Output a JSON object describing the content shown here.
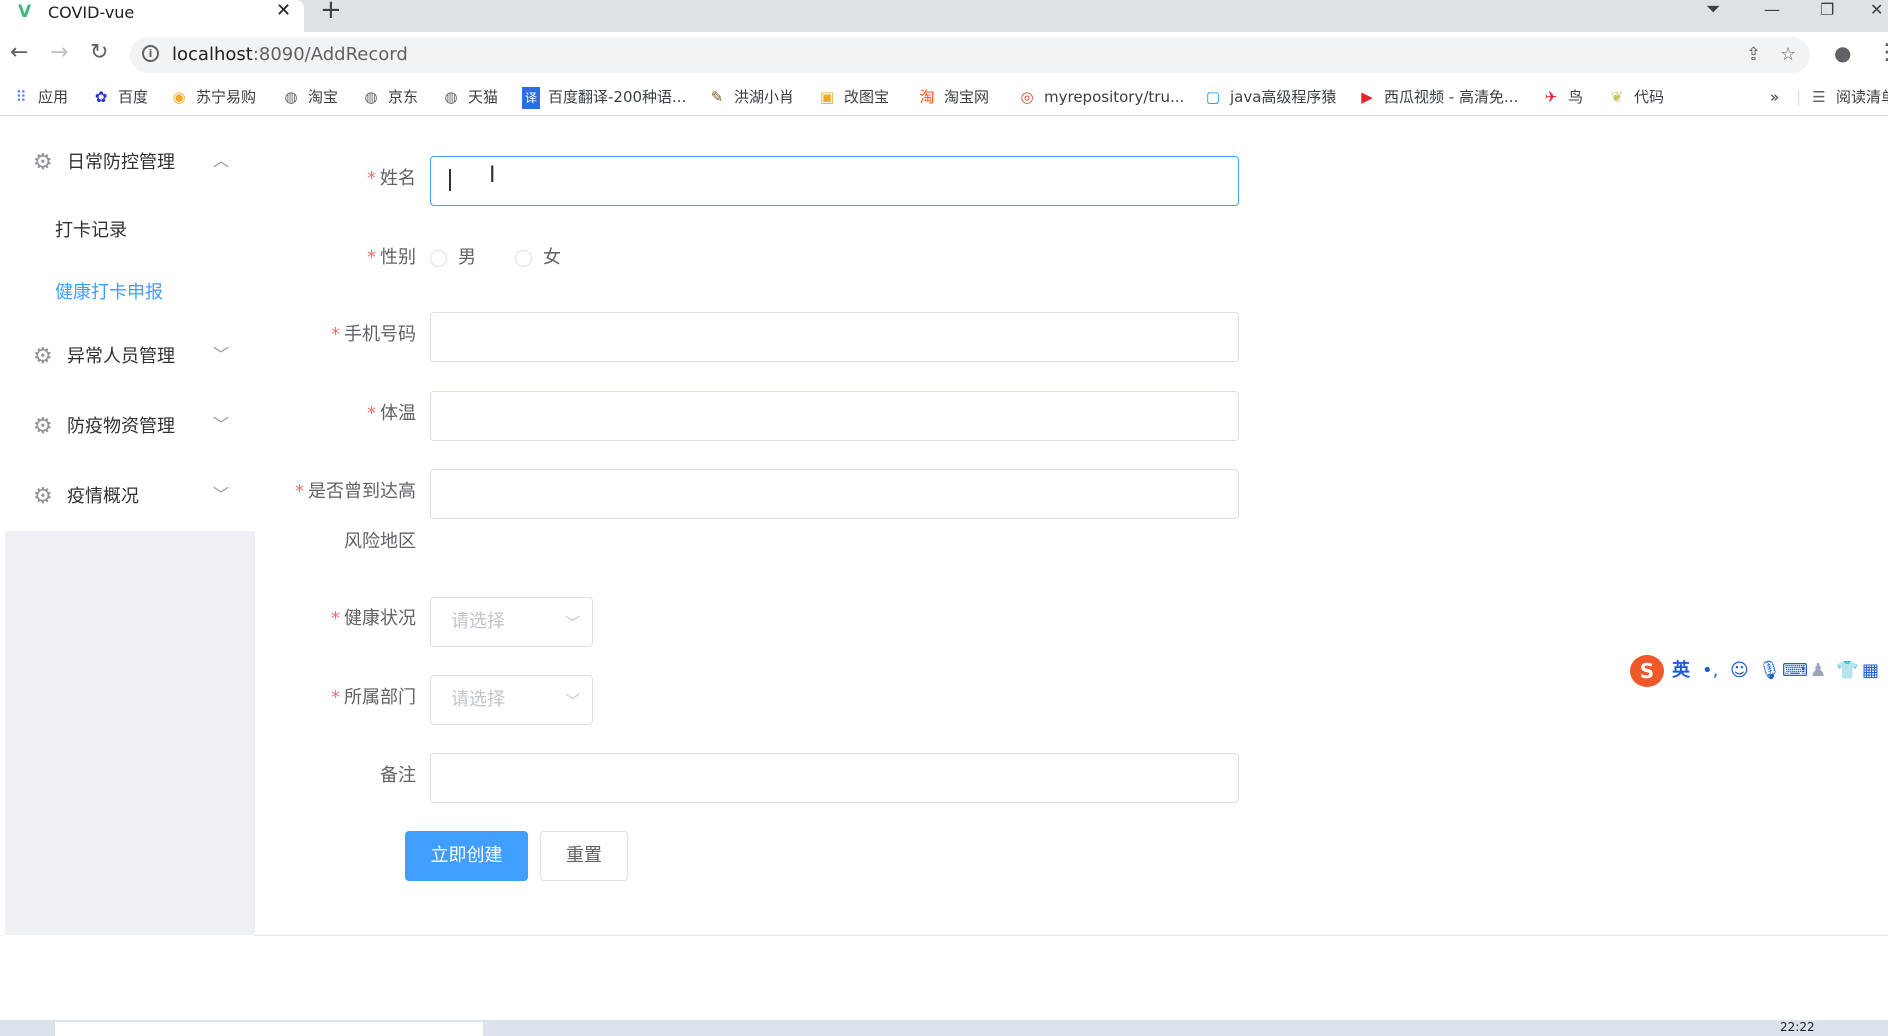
{
  "browser": {
    "tab_title": "COVID-vue",
    "tab_close": "✕",
    "new_tab": "+",
    "url_host": "localhost",
    "url_rest": ":8090/AddRecord",
    "window_controls": [
      "—",
      "❐",
      "✕"
    ]
  },
  "bookmarks": [
    {
      "icon": "apps-grid-icon",
      "label": "应用"
    },
    {
      "icon": "baidu-paw-icon",
      "label": "百度"
    },
    {
      "icon": "suning-lion-icon",
      "label": "苏宁易购"
    },
    {
      "icon": "globe-icon",
      "label": "淘宝"
    },
    {
      "icon": "globe-icon",
      "label": "京东"
    },
    {
      "icon": "globe-icon",
      "label": "天猫"
    },
    {
      "icon": "translate-icon",
      "label": "百度翻译-200种语..."
    },
    {
      "icon": "honghu-icon",
      "label": "洪湖小肖"
    },
    {
      "icon": "gaitubao-icon",
      "label": "改图宝"
    },
    {
      "icon": "taobao-icon",
      "label": "淘宝网"
    },
    {
      "icon": "chrome-icon",
      "label": "myrepository/tru..."
    },
    {
      "icon": "bilibili-tv-icon",
      "label": "java高级程序猿"
    },
    {
      "icon": "xigua-play-icon",
      "label": "西瓜视频 - 高清免..."
    },
    {
      "icon": "bird-icon",
      "label": "鸟"
    },
    {
      "icon": "code-leaf-icon",
      "label": "代码"
    }
  ],
  "bookmarks_more": "»",
  "reading_list": "阅读清单",
  "sidebar": {
    "menus": [
      {
        "label": "日常防控管理",
        "expanded": true
      },
      {
        "label": "异常人员管理",
        "expanded": false
      },
      {
        "label": "防疫物资管理",
        "expanded": false
      },
      {
        "label": "疫情概况",
        "expanded": false
      }
    ],
    "sub_items": [
      {
        "label": "打卡记录",
        "active": false
      },
      {
        "label": "健康打卡申报",
        "active": true
      }
    ],
    "chevron_up": "︿",
    "chevron_down": "﹀"
  },
  "form": {
    "required_mark": "*",
    "name_label": "姓名",
    "name_value": "",
    "gender_label": "性别",
    "gender_options": [
      "男",
      "女"
    ],
    "phone_label": "手机号码",
    "phone_value": "",
    "temperature_label": "体温",
    "temperature_value": "",
    "high_risk_label_line1": "是否曾到达高",
    "high_risk_label_line2": "风险地区",
    "high_risk_value": "",
    "health_label": "健康状况",
    "health_placeholder": "请选择",
    "dept_label": "所属部门",
    "dept_placeholder": "请选择",
    "remark_label": "备注",
    "remark_value": "",
    "submit_label": "立即创建",
    "reset_label": "重置"
  },
  "ime": {
    "logo": "S",
    "mode": "英"
  },
  "taskbar": {
    "clock": "22:22"
  },
  "colors": {
    "primary": "#409eff",
    "required": "#f56c6c",
    "border": "#dcdfe6",
    "placeholder": "#c0c4cc",
    "sidebar_bg": "#eef0f3"
  }
}
